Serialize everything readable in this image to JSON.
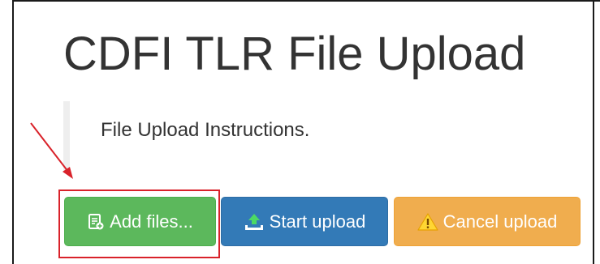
{
  "page": {
    "title": "CDFI TLR File Upload"
  },
  "instructions": {
    "text": "File Upload Instructions."
  },
  "buttons": {
    "add_label": "Add files...",
    "start_label": "Start upload",
    "cancel_label": "Cancel upload"
  },
  "icons": {
    "add": "file-add-icon",
    "start": "upload-tray-icon",
    "cancel": "warning-icon"
  },
  "colors": {
    "success": "#5cb85c",
    "primary": "#337ab7",
    "warning": "#f0ad4e",
    "annotation": "#d9222a"
  }
}
